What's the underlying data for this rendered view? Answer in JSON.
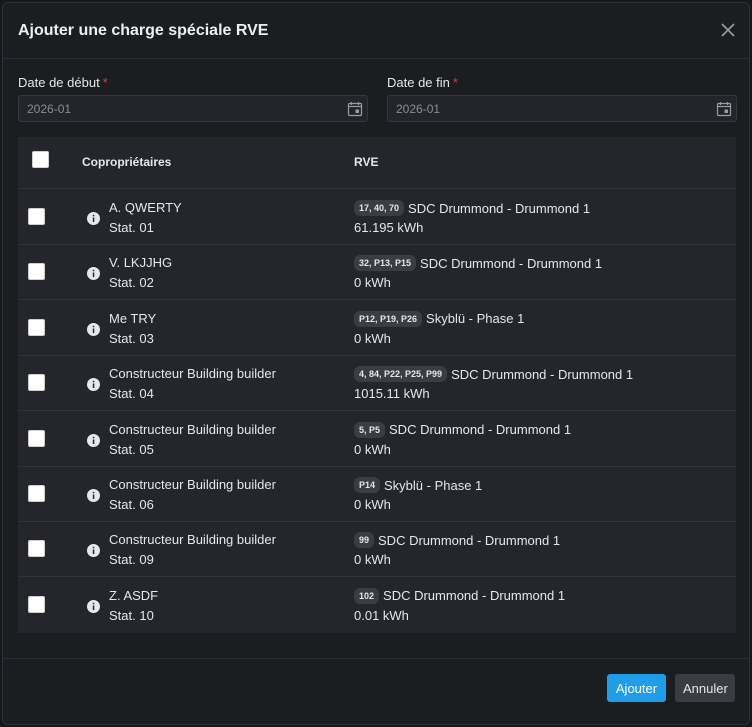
{
  "dialog": {
    "title": "Ajouter une charge spéciale RVE",
    "close_icon": "close-icon"
  },
  "form": {
    "start_label": "Date de début",
    "start_value": "2026-01",
    "end_label": "Date de fin",
    "end_value": "2026-01",
    "required_mark": "*",
    "calendar_icon": "calendar-icon"
  },
  "table": {
    "col_owners": "Copropriétaires",
    "col_rve": "RVE",
    "rows": [
      {
        "name": "A. QWERTY",
        "stat": "Stat. 01",
        "badge": "17, 40, 70",
        "rve": "SDC Drummond - Drummond 1",
        "kwh": "61.195 kWh"
      },
      {
        "name": "V. LKJJHG",
        "stat": "Stat. 02",
        "badge": "32, P13, P15",
        "rve": "SDC Drummond - Drummond 1",
        "kwh": "0 kWh"
      },
      {
        "name": "Me TRY",
        "stat": "Stat. 03",
        "badge": "P12, P19, P26",
        "rve": "Skyblü - Phase 1",
        "kwh": "0 kWh"
      },
      {
        "name": "Constructeur Building builder",
        "stat": "Stat. 04",
        "badge": "4, 84, P22, P25, P99",
        "rve": "SDC Drummond - Drummond 1",
        "kwh": "1015.11 kWh"
      },
      {
        "name": "Constructeur Building builder",
        "stat": "Stat. 05",
        "badge": "5, P5",
        "rve": "SDC Drummond - Drummond 1",
        "kwh": "0 kWh"
      },
      {
        "name": "Constructeur Building builder",
        "stat": "Stat. 06",
        "badge": "P14",
        "rve": "Skyblü - Phase 1",
        "kwh": "0 kWh"
      },
      {
        "name": "Constructeur Building builder",
        "stat": "Stat. 09",
        "badge": "99",
        "rve": "SDC Drummond - Drummond 1",
        "kwh": "0 kWh"
      },
      {
        "name": "Z. ASDF",
        "stat": "Stat. 10",
        "badge": "102",
        "rve": "SDC Drummond - Drummond 1",
        "kwh": "0.01 kWh"
      }
    ]
  },
  "footer": {
    "add_label": "Ajouter",
    "cancel_label": "Annuler"
  },
  "colors": {
    "accent": "#1e9ee8",
    "required": "#e2363e",
    "background": "#1c1d21",
    "table_bg": "#25262b"
  }
}
